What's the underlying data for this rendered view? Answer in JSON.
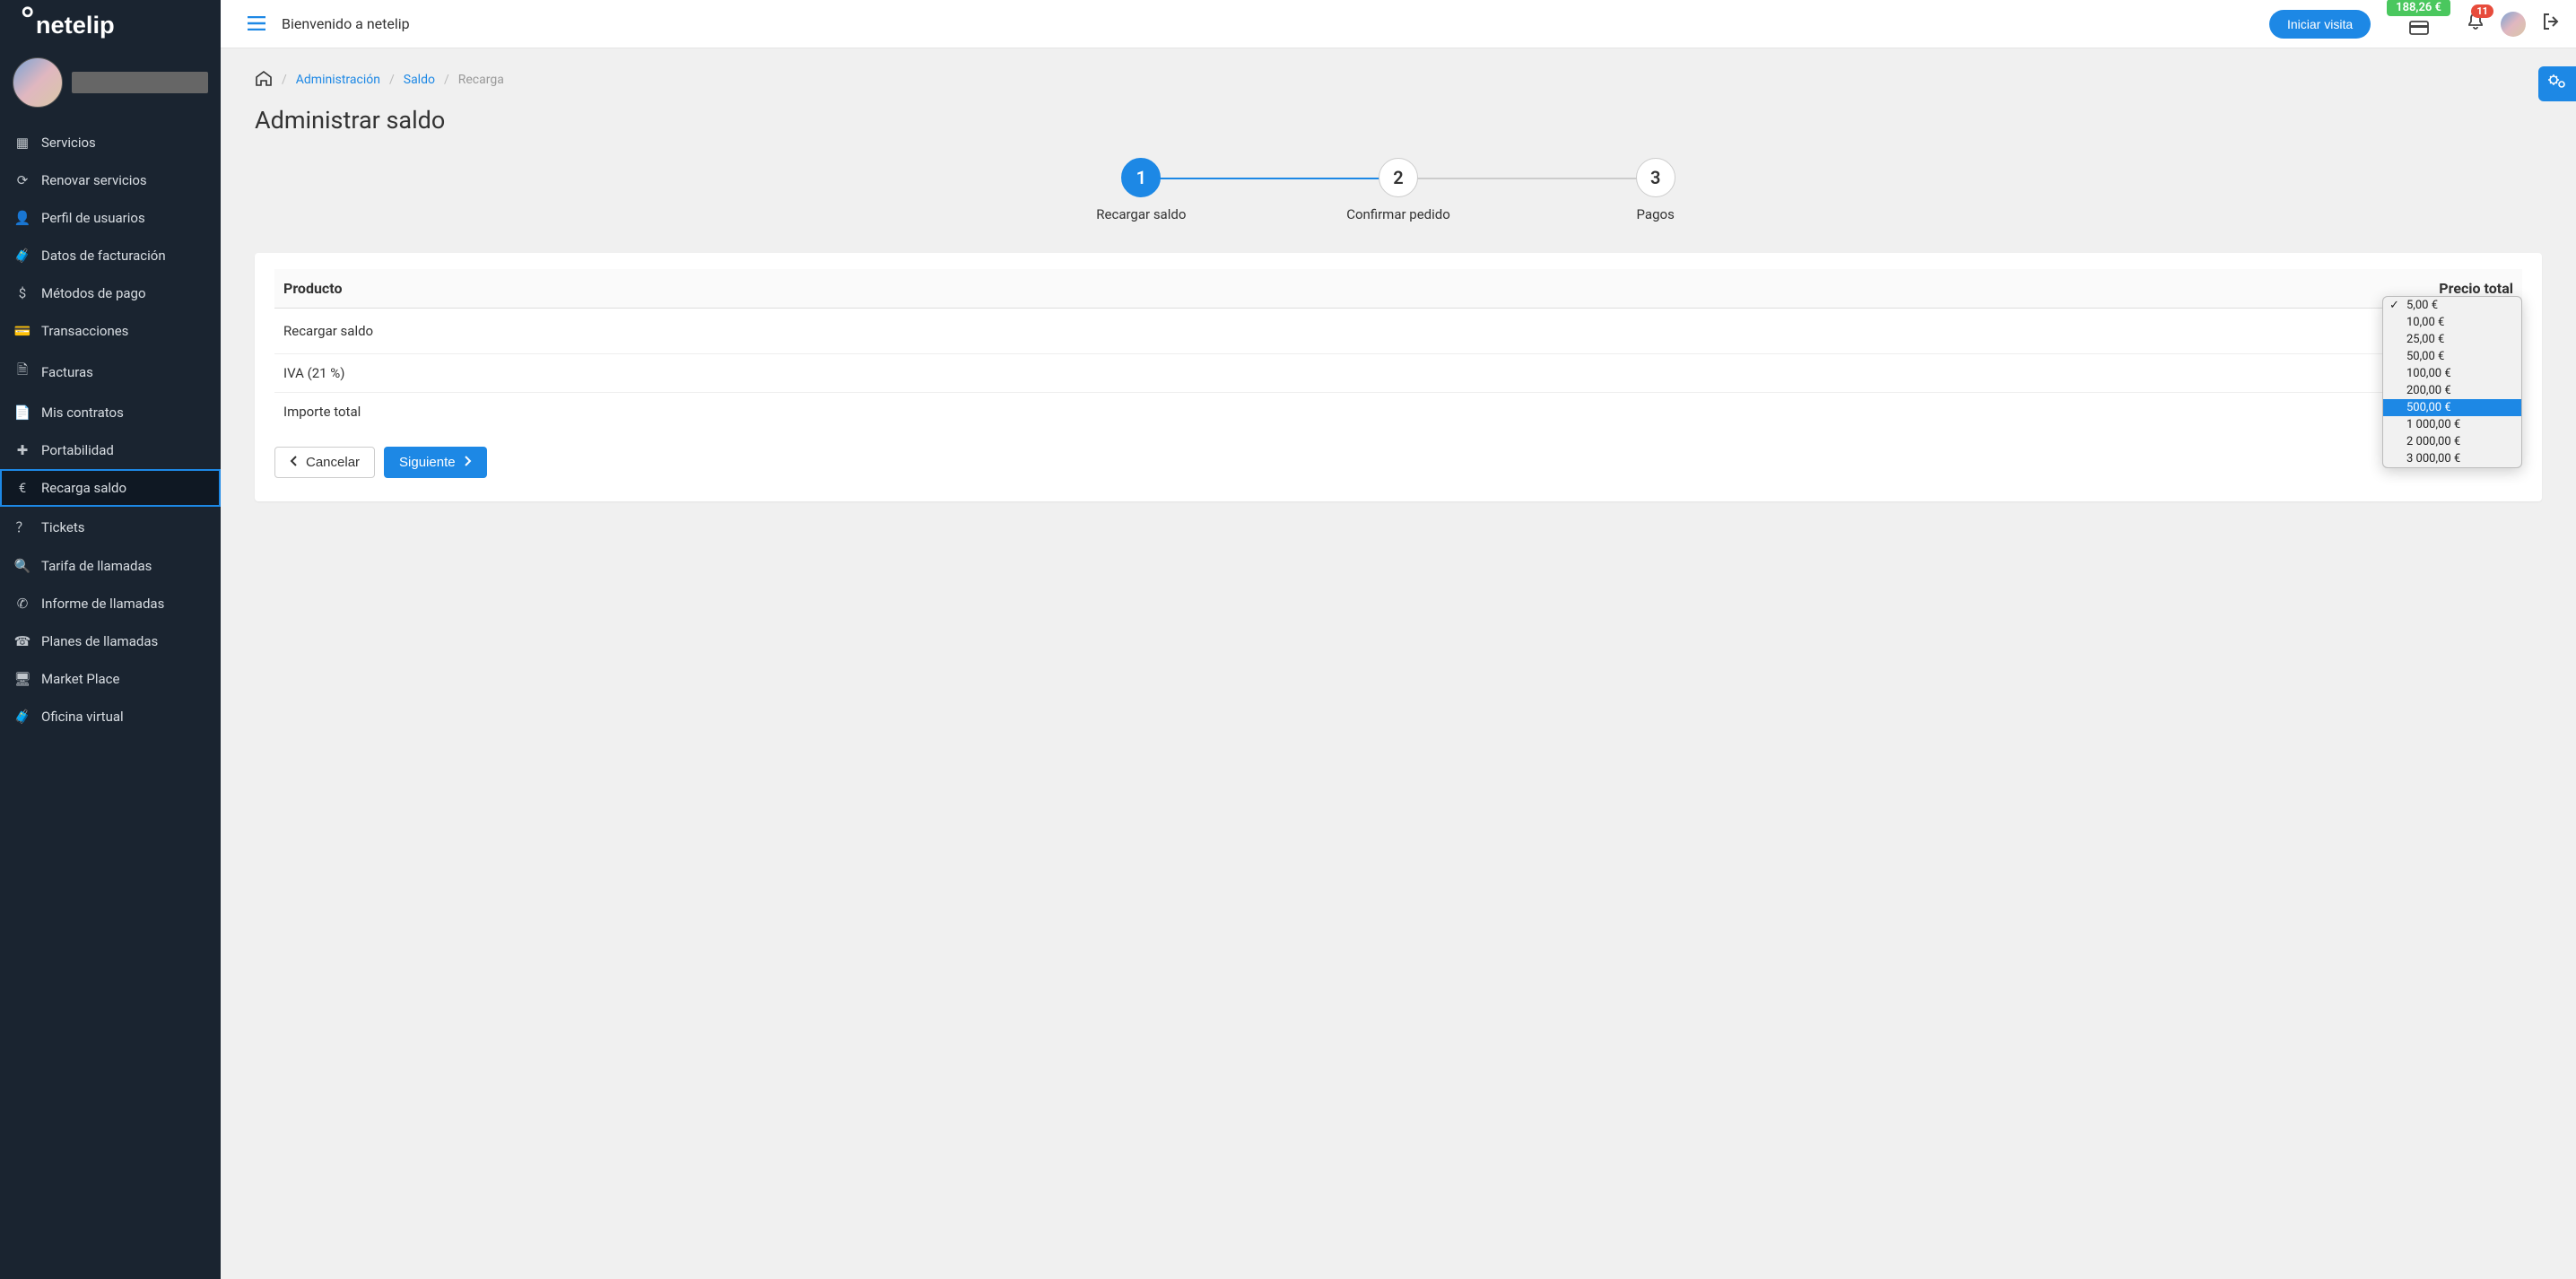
{
  "brand": "netelip",
  "header": {
    "welcome": "Bienvenido a netelip",
    "start_visit": "Iniciar visita",
    "balance": "188,26 €",
    "notif_count": "11"
  },
  "sidebar": {
    "items": [
      {
        "label": "Servicios",
        "icon": "grid"
      },
      {
        "label": "Renovar servicios",
        "icon": "refresh"
      },
      {
        "label": "Perfil de usuarios",
        "icon": "user"
      },
      {
        "label": "Datos de facturación",
        "icon": "briefcase"
      },
      {
        "label": "Métodos de pago",
        "icon": "dollar"
      },
      {
        "label": "Transacciones",
        "icon": "card"
      },
      {
        "label": "Facturas",
        "icon": "document"
      },
      {
        "label": "Mis contratos",
        "icon": "file"
      },
      {
        "label": "Portabilidad",
        "icon": "plus"
      },
      {
        "label": "Recarga saldo",
        "icon": "euro"
      },
      {
        "label": "Tickets",
        "icon": "help"
      },
      {
        "label": "Tarifa de llamadas",
        "icon": "search"
      },
      {
        "label": "Informe de llamadas",
        "icon": "phone"
      },
      {
        "label": "Planes de llamadas",
        "icon": "plan"
      },
      {
        "label": "Market Place",
        "icon": "market"
      },
      {
        "label": "Oficina virtual",
        "icon": "briefcase"
      }
    ],
    "active_index": 9
  },
  "breadcrumb": {
    "items": [
      {
        "label": "Administración",
        "link": true
      },
      {
        "label": "Saldo",
        "link": true
      },
      {
        "label": "Recarga",
        "link": false
      }
    ]
  },
  "page_title": "Administrar saldo",
  "steps": [
    {
      "num": "1",
      "label": "Recargar saldo",
      "active": true
    },
    {
      "num": "2",
      "label": "Confirmar pedido",
      "active": false
    },
    {
      "num": "3",
      "label": "Pagos",
      "active": false
    }
  ],
  "table": {
    "headers": {
      "product": "Producto",
      "total": "Precio total"
    },
    "rows": [
      {
        "label": "Recargar saldo",
        "value_is_select": true
      },
      {
        "label": "IVA (21 %)",
        "value": "€"
      },
      {
        "label": "Importe total",
        "value": "€"
      }
    ]
  },
  "dropdown": {
    "selected_display": "5,00 €",
    "options": [
      "5,00 €",
      "10,00 €",
      "25,00 €",
      "50,00 €",
      "100,00 €",
      "200,00 €",
      "500,00 €",
      "1 000,00 €",
      "2 000,00 €",
      "3 000,00 €"
    ],
    "selected_index": 0,
    "highlight_index": 6
  },
  "buttons": {
    "cancel": "Cancelar",
    "next": "Siguiente"
  }
}
